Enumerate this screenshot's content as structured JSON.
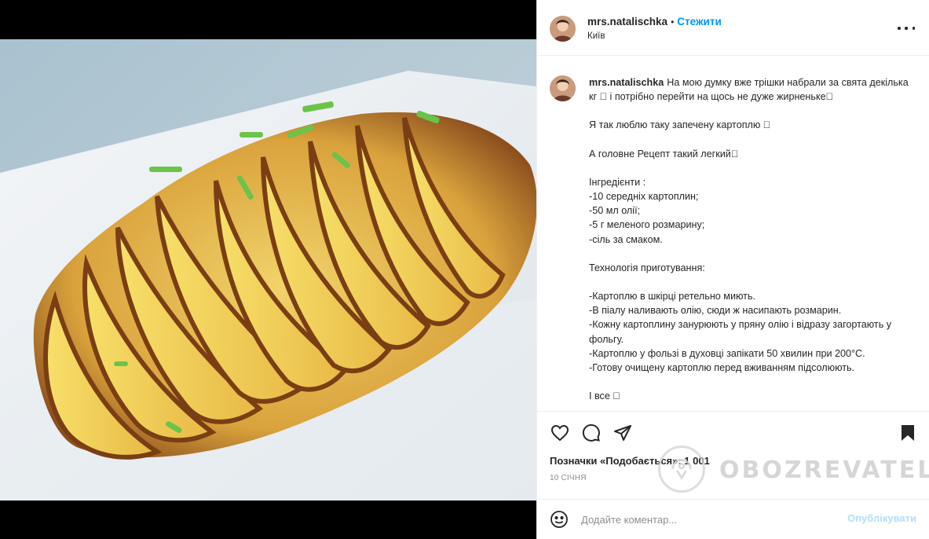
{
  "post": {
    "username": "mrs.natalischka",
    "dot": "•",
    "follow_label": "Стежити",
    "location": "Київ"
  },
  "caption": {
    "username": "mrs.natalischka",
    "intro": "На мою думку вже трішки набрали за свята декілька кг \u0000 і потрібно перейти на щось не дуже жирненьке\u0000",
    "line_love": "Я так люблю таку запечену картоплю \u0000",
    "line_recipe": "А головне Рецепт такий легкий\u0000",
    "ingredients_title": "Інгредієнти :",
    "ingredients": [
      "-10 середніх картоплин;",
      "-50 мл олії;",
      "-5 г меленого розмарину;",
      "-сіль за смаком."
    ],
    "technology_title": "Технологія приготування:",
    "steps": [
      "-Картоплю в шкірці ретельно миють.",
      "-В піалу наливають олію, сюди ж насипають розмарин.",
      "-Кожну картоплину занурюють у пряну олію і відразу загортають у фольгу.",
      "-Картоплю у фользі в духовці запікати 50 хвилин при 200°C.",
      "-Готову очищену картоплю перед вживанням підсолюють."
    ],
    "ending": "І все \u0000"
  },
  "actions": {
    "like_icon": "heart-outline-icon",
    "comment_icon": "comment-bubble-icon",
    "share_icon": "paper-plane-icon",
    "save_icon": "bookmark-filled-icon"
  },
  "likes_text": "Позначки «Подобається»: 1 001",
  "date": "10 СІЧНЯ",
  "watermark": "OBOZREVATEL",
  "comment_box": {
    "placeholder": "Додайте коментар...",
    "post_label": "Опублікувати"
  },
  "colors": {
    "link_blue": "#0095f6",
    "post_disabled": "#b2dffc",
    "border": "#efefef"
  }
}
